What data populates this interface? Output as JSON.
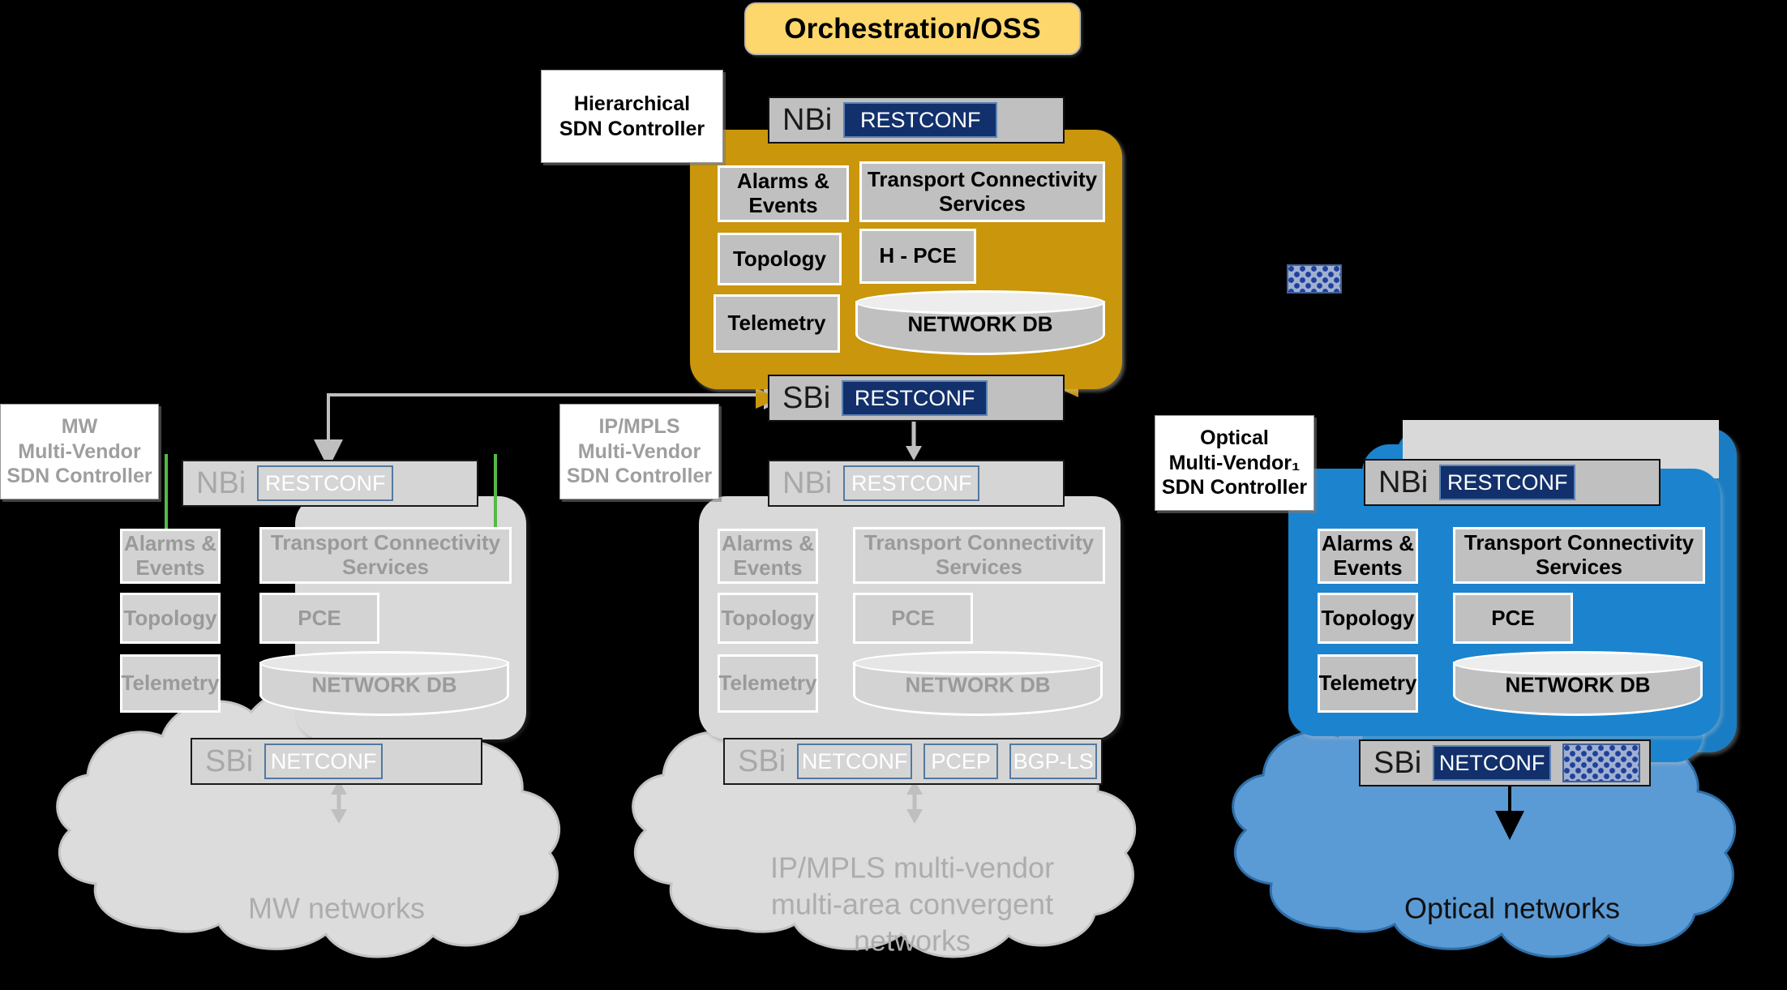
{
  "orchestration": {
    "label": "Orchestration/OSS"
  },
  "legend": {
    "pattern_swatch": "checker-pattern-swatch"
  },
  "hierarchical": {
    "callout": "Hierarchical\nSDN Controller",
    "callout_line1": "Hierarchical",
    "callout_line2": "SDN Controller",
    "nbi": {
      "label": "NBi",
      "protocols": [
        "RESTCONF"
      ]
    },
    "sbi": {
      "label": "SBi",
      "protocols": [
        "RESTCONF"
      ]
    },
    "modules": {
      "alarms": "Alarms &\nEvents",
      "alarms_l1": "Alarms &",
      "alarms_l2": "Events",
      "transport_l1": "Transport Connectivity",
      "transport_l2": "Services",
      "topology": "Topology",
      "pce": "H - PCE",
      "telemetry": "Telemetry",
      "db": "NETWORK DB"
    }
  },
  "domains": [
    {
      "id": "mw",
      "callout_l1": "MW",
      "callout_l2": "Multi-Vendor",
      "callout_l3": "SDN Controller",
      "nbi": {
        "label": "NBi",
        "protocols": [
          "RESTCONF"
        ]
      },
      "sbi": {
        "label": "SBi",
        "protocols": [
          "NETCONF"
        ]
      },
      "modules": {
        "alarms_l1": "Alarms &",
        "alarms_l2": "Events",
        "transport_l1": "Transport Connectivity",
        "transport_l2": "Services",
        "topology": "Topology",
        "pce": "PCE",
        "telemetry": "Telemetry",
        "db": "NETWORK DB"
      },
      "cloud_lines": [
        "MW networks"
      ]
    },
    {
      "id": "ipmpls",
      "callout_l1": "IP/MPLS",
      "callout_l2": "Multi-Vendor",
      "callout_l3": "SDN Controller",
      "nbi": {
        "label": "NBi",
        "protocols": [
          "RESTCONF"
        ]
      },
      "sbi": {
        "label": "SBi",
        "protocols": [
          "NETCONF",
          "PCEP",
          "BGP-LS"
        ]
      },
      "modules": {
        "alarms_l1": "Alarms &",
        "alarms_l2": "Events",
        "transport_l1": "Transport Connectivity",
        "transport_l2": "Services",
        "topology": "Topology",
        "pce": "PCE",
        "telemetry": "Telemetry",
        "db": "NETWORK DB"
      },
      "cloud_lines": [
        "IP/MPLS multi-vendor",
        "multi-area convergent",
        "networks"
      ]
    },
    {
      "id": "optical",
      "callout_l1": "Optical",
      "callout_l2": "Multi-Vendor₁",
      "callout_l3": "SDN Controller",
      "nbi": {
        "label": "NBi",
        "protocols": [
          "RESTCONF"
        ]
      },
      "sbi": {
        "label": "SBi",
        "protocols": [
          "NETCONF"
        ]
      },
      "modules": {
        "alarms_l1": "Alarms &",
        "alarms_l2": "Events",
        "transport_l1": "Transport Connectivity",
        "transport_l2": "Services",
        "topology": "Topology",
        "pce": "PCE",
        "telemetry": "Telemetry",
        "db": "NETWORK DB"
      },
      "cloud_lines": [
        "Optical networks"
      ]
    }
  ],
  "colors": {
    "orchestration_fill": "#FDD76B",
    "hierarchical_fill": "#C9960C",
    "dim_controller_fill": "#D9D9D9",
    "active_controller_fill": "#1C84CE",
    "protocol_fill": "#12306B",
    "module_fill": "#C0C0C0",
    "green_link": "#54B947",
    "cloud_grey": "#DCDCDC",
    "cloud_blue": "#5B9BD5"
  }
}
